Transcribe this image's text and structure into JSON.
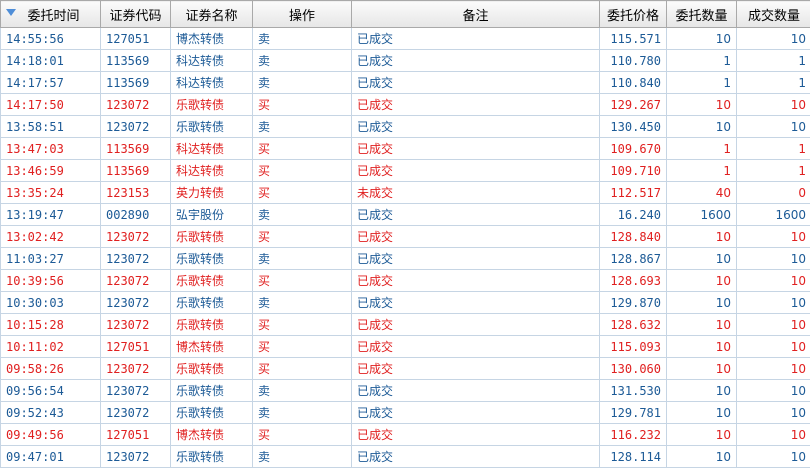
{
  "table": {
    "headers": {
      "time": "委托时间",
      "code": "证券代码",
      "name": "证券名称",
      "op": "操作",
      "remark": "备注",
      "price": "委托价格",
      "qty": "委托数量",
      "filled": "成交数量"
    },
    "rows": [
      {
        "time": "14:55:56",
        "code": "127051",
        "name": "博杰转债",
        "op": "卖",
        "remark": "已成交",
        "price": "115.571",
        "qty": "10",
        "filled": "10",
        "side": "sell"
      },
      {
        "time": "14:18:01",
        "code": "113569",
        "name": "科达转债",
        "op": "卖",
        "remark": "已成交",
        "price": "110.780",
        "qty": "1",
        "filled": "1",
        "side": "sell"
      },
      {
        "time": "14:17:57",
        "code": "113569",
        "name": "科达转债",
        "op": "卖",
        "remark": "已成交",
        "price": "110.840",
        "qty": "1",
        "filled": "1",
        "side": "sell"
      },
      {
        "time": "14:17:50",
        "code": "123072",
        "name": "乐歌转债",
        "op": "买",
        "remark": "已成交",
        "price": "129.267",
        "qty": "10",
        "filled": "10",
        "side": "buy"
      },
      {
        "time": "13:58:51",
        "code": "123072",
        "name": "乐歌转债",
        "op": "卖",
        "remark": "已成交",
        "price": "130.450",
        "qty": "10",
        "filled": "10",
        "side": "sell"
      },
      {
        "time": "13:47:03",
        "code": "113569",
        "name": "科达转债",
        "op": "买",
        "remark": "已成交",
        "price": "109.670",
        "qty": "1",
        "filled": "1",
        "side": "buy"
      },
      {
        "time": "13:46:59",
        "code": "113569",
        "name": "科达转债",
        "op": "买",
        "remark": "已成交",
        "price": "109.710",
        "qty": "1",
        "filled": "1",
        "side": "buy"
      },
      {
        "time": "13:35:24",
        "code": "123153",
        "name": "英力转债",
        "op": "买",
        "remark": "未成交",
        "price": "112.517",
        "qty": "40",
        "filled": "0",
        "side": "buy"
      },
      {
        "time": "13:19:47",
        "code": "002890",
        "name": "弘宇股份",
        "op": "卖",
        "remark": "已成交",
        "price": "16.240",
        "qty": "1600",
        "filled": "1600",
        "side": "sell"
      },
      {
        "time": "13:02:42",
        "code": "123072",
        "name": "乐歌转债",
        "op": "买",
        "remark": "已成交",
        "price": "128.840",
        "qty": "10",
        "filled": "10",
        "side": "buy"
      },
      {
        "time": "11:03:27",
        "code": "123072",
        "name": "乐歌转债",
        "op": "卖",
        "remark": "已成交",
        "price": "128.867",
        "qty": "10",
        "filled": "10",
        "side": "sell"
      },
      {
        "time": "10:39:56",
        "code": "123072",
        "name": "乐歌转债",
        "op": "买",
        "remark": "已成交",
        "price": "128.693",
        "qty": "10",
        "filled": "10",
        "side": "buy"
      },
      {
        "time": "10:30:03",
        "code": "123072",
        "name": "乐歌转债",
        "op": "卖",
        "remark": "已成交",
        "price": "129.870",
        "qty": "10",
        "filled": "10",
        "side": "sell"
      },
      {
        "time": "10:15:28",
        "code": "123072",
        "name": "乐歌转债",
        "op": "买",
        "remark": "已成交",
        "price": "128.632",
        "qty": "10",
        "filled": "10",
        "side": "buy"
      },
      {
        "time": "10:11:02",
        "code": "127051",
        "name": "博杰转债",
        "op": "买",
        "remark": "已成交",
        "price": "115.093",
        "qty": "10",
        "filled": "10",
        "side": "buy"
      },
      {
        "time": "09:58:26",
        "code": "123072",
        "name": "乐歌转债",
        "op": "买",
        "remark": "已成交",
        "price": "130.060",
        "qty": "10",
        "filled": "10",
        "side": "buy"
      },
      {
        "time": "09:56:54",
        "code": "123072",
        "name": "乐歌转债",
        "op": "卖",
        "remark": "已成交",
        "price": "131.530",
        "qty": "10",
        "filled": "10",
        "side": "sell"
      },
      {
        "time": "09:52:43",
        "code": "123072",
        "name": "乐歌转债",
        "op": "卖",
        "remark": "已成交",
        "price": "129.781",
        "qty": "10",
        "filled": "10",
        "side": "sell"
      },
      {
        "time": "09:49:56",
        "code": "127051",
        "name": "博杰转债",
        "op": "买",
        "remark": "已成交",
        "price": "116.232",
        "qty": "10",
        "filled": "10",
        "side": "buy"
      },
      {
        "time": "09:47:01",
        "code": "123072",
        "name": "乐歌转债",
        "op": "卖",
        "remark": "已成交",
        "price": "128.114",
        "qty": "10",
        "filled": "10",
        "side": "sell"
      }
    ]
  },
  "colors": {
    "sell": "#1c5a96",
    "buy": "#e02020",
    "grid_line": "#c6d5e4",
    "sort_arrow": "#4f8ed8"
  },
  "icons": {
    "sort": "sort-descending-icon"
  }
}
